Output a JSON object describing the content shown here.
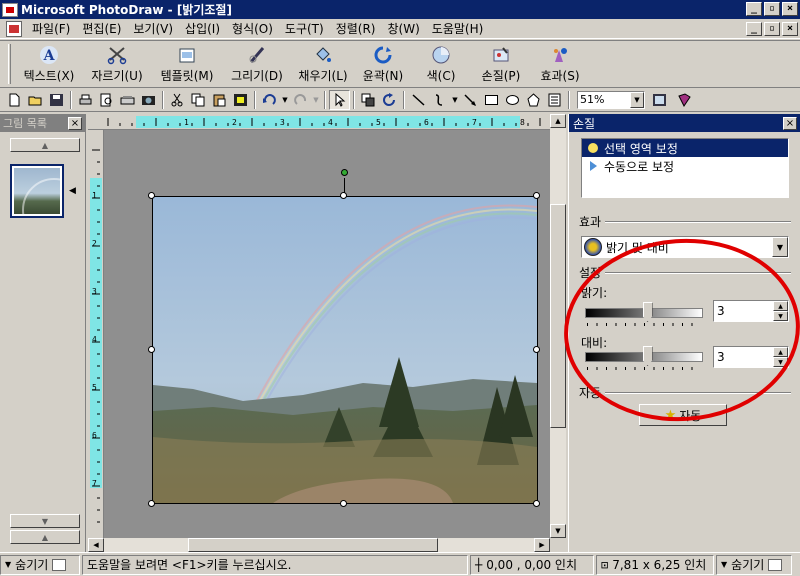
{
  "window": {
    "title": "Microsoft PhotoDraw - [밝기조절]",
    "minimize": "_",
    "restore": "▫",
    "close": "×"
  },
  "menu": [
    "파일(F)",
    "편집(E)",
    "보기(V)",
    "삽입(I)",
    "형식(O)",
    "도구(T)",
    "정렬(R)",
    "창(W)",
    "도움말(H)"
  ],
  "big_toolbar": [
    {
      "label": "텍스트(X)",
      "icon": "text-a-icon"
    },
    {
      "label": "자르기(U)",
      "icon": "scissors-icon"
    },
    {
      "label": "템플릿(M)",
      "icon": "template-icon"
    },
    {
      "label": "그리기(D)",
      "icon": "draw-pen-icon"
    },
    {
      "label": "채우기(L)",
      "icon": "fill-bucket-icon"
    },
    {
      "label": "윤곽(N)",
      "icon": "outline-icon"
    },
    {
      "label": "색(C)",
      "icon": "color-icon"
    },
    {
      "label": "손질(P)",
      "icon": "touchup-icon"
    },
    {
      "label": "효과(S)",
      "icon": "effects-icon"
    }
  ],
  "zoom": "51%",
  "left_panel": {
    "title": "그림 목록",
    "close": "×"
  },
  "ruler": {
    "h_numbers": [
      "1",
      "2",
      "3",
      "4",
      "5",
      "6",
      "7",
      "8"
    ],
    "v_numbers": [
      "1",
      "2",
      "3",
      "4",
      "5",
      "6",
      "7"
    ]
  },
  "right_panel": {
    "title": "손질",
    "close": "×",
    "options": [
      {
        "label": "선택 영역 보정",
        "selected": true
      },
      {
        "label": "수동으로 보정",
        "selected": false
      }
    ],
    "effect_group": "효과",
    "effect_value": "밝기 및 대비",
    "settings_group": "설정",
    "brightness_label": "밝기:",
    "brightness_value": "3",
    "brightness_level": 0.53,
    "contrast_label": "대비:",
    "contrast_value": "3",
    "contrast_level": 0.53,
    "auto_group": "자동",
    "auto_button": "자동"
  },
  "status": {
    "left_toggle": "숨기기",
    "hint": "도움말을 보려면 <F1>키를 누르십시오.",
    "position": "0,00 , 0,00 인치",
    "size": "7,81 x 6,25 인치",
    "right_toggle": "숨기기"
  },
  "colors": {
    "title_bar": "#0a246a",
    "ruler_highlight": "#7fe5e5",
    "annotation_circle": "#e00000"
  }
}
